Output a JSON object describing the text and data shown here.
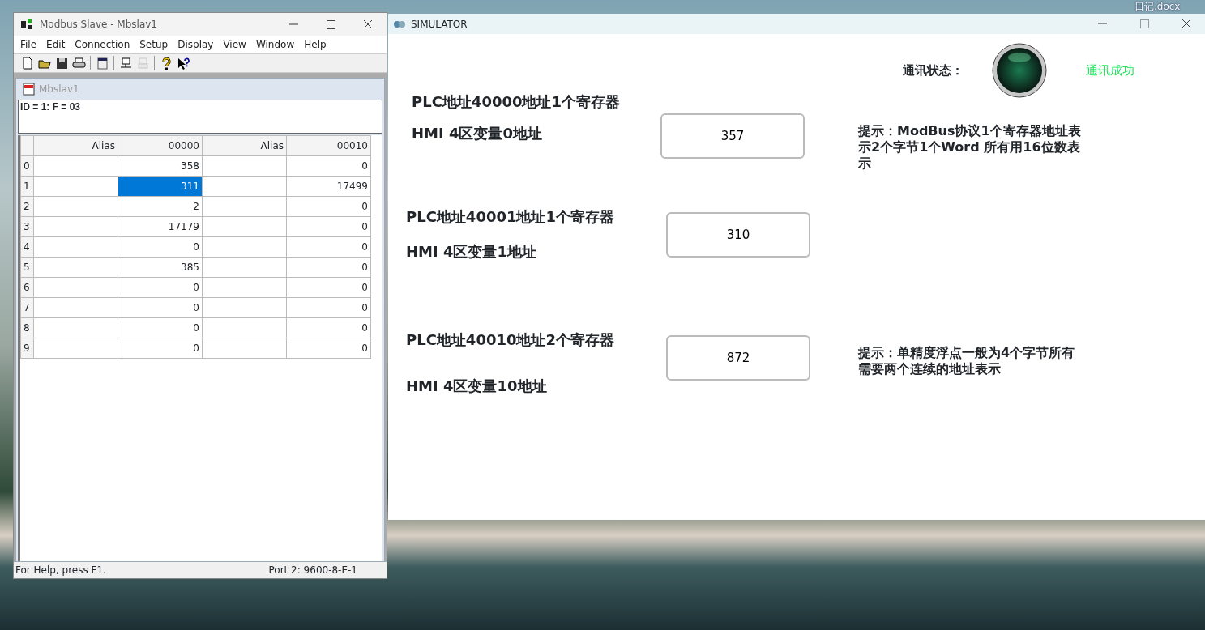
{
  "desktop": {
    "icon_label": "日记.docx"
  },
  "modbus_window": {
    "title": "Modbus Slave - Mbslav1",
    "menu": [
      "File",
      "Edit",
      "Connection",
      "Setup",
      "Display",
      "View",
      "Window",
      "Help"
    ],
    "toolbar": [
      {
        "kind": "new",
        "disabled": false
      },
      {
        "kind": "open",
        "disabled": false
      },
      {
        "kind": "save",
        "disabled": false
      },
      {
        "kind": "print",
        "disabled": false
      },
      {
        "kind": "sep"
      },
      {
        "kind": "window",
        "disabled": false
      },
      {
        "kind": "sep"
      },
      {
        "kind": "connect",
        "disabled": false
      },
      {
        "kind": "disconnect",
        "disabled": true
      },
      {
        "kind": "sep"
      },
      {
        "kind": "help",
        "disabled": false
      },
      {
        "kind": "context-help",
        "disabled": false
      }
    ],
    "child": {
      "title": "Mbslav1",
      "header": "ID = 1: F = 03",
      "columns": [
        {
          "heading": "Alias",
          "kind": "alias"
        },
        {
          "heading": "00000",
          "kind": "value"
        },
        {
          "heading": "Alias",
          "kind": "alias"
        },
        {
          "heading": "00010",
          "kind": "value"
        }
      ],
      "rows": [
        {
          "header": "0",
          "cells": [
            {
              "text": "",
              "selected": false
            },
            {
              "text": "358",
              "selected": false
            },
            {
              "text": "",
              "selected": false
            },
            {
              "text": "0",
              "selected": false
            }
          ]
        },
        {
          "header": "1",
          "cells": [
            {
              "text": "",
              "selected": false
            },
            {
              "text": "311",
              "selected": true
            },
            {
              "text": "",
              "selected": false
            },
            {
              "text": "17499",
              "selected": false
            }
          ]
        },
        {
          "header": "2",
          "cells": [
            {
              "text": "",
              "selected": false
            },
            {
              "text": "2",
              "selected": false
            },
            {
              "text": "",
              "selected": false
            },
            {
              "text": "0",
              "selected": false
            }
          ]
        },
        {
          "header": "3",
          "cells": [
            {
              "text": "",
              "selected": false
            },
            {
              "text": "17179",
              "selected": false
            },
            {
              "text": "",
              "selected": false
            },
            {
              "text": "0",
              "selected": false
            }
          ]
        },
        {
          "header": "4",
          "cells": [
            {
              "text": "",
              "selected": false
            },
            {
              "text": "0",
              "selected": false
            },
            {
              "text": "",
              "selected": false
            },
            {
              "text": "0",
              "selected": false
            }
          ]
        },
        {
          "header": "5",
          "cells": [
            {
              "text": "",
              "selected": false
            },
            {
              "text": "385",
              "selected": false
            },
            {
              "text": "",
              "selected": false
            },
            {
              "text": "0",
              "selected": false
            }
          ]
        },
        {
          "header": "6",
          "cells": [
            {
              "text": "",
              "selected": false
            },
            {
              "text": "0",
              "selected": false
            },
            {
              "text": "",
              "selected": false
            },
            {
              "text": "0",
              "selected": false
            }
          ]
        },
        {
          "header": "7",
          "cells": [
            {
              "text": "",
              "selected": false
            },
            {
              "text": "0",
              "selected": false
            },
            {
              "text": "",
              "selected": false
            },
            {
              "text": "0",
              "selected": false
            }
          ]
        },
        {
          "header": "8",
          "cells": [
            {
              "text": "",
              "selected": false
            },
            {
              "text": "0",
              "selected": false
            },
            {
              "text": "",
              "selected": false
            },
            {
              "text": "0",
              "selected": false
            }
          ]
        },
        {
          "header": "9",
          "cells": [
            {
              "text": "",
              "selected": false
            },
            {
              "text": "0",
              "selected": false
            },
            {
              "text": "",
              "selected": false
            },
            {
              "text": "0",
              "selected": false
            }
          ]
        }
      ]
    },
    "status_bar": {
      "help": "For Help, press F1.",
      "port": "Port 2: 9600-8-E-1"
    }
  },
  "simulator": {
    "title": "SIMULATOR",
    "status_label": "通讯状态：",
    "status_text": "通讯成功",
    "sections": [
      {
        "plc": "PLC地址40000地址1个寄存器",
        "hmi": "HMI 4区变量0地址",
        "value": "357",
        "hint": "提示：ModBus协议1个寄存器地址表示2个字节1个Word 所有用16位数表示"
      },
      {
        "plc": "PLC地址40001地址1个寄存器",
        "hmi": "HMI 4区变量1地址",
        "value": "310"
      },
      {
        "plc": "PLC地址40010地址2个寄存器",
        "hmi": "HMI 4区变量10地址",
        "value": "872",
        "hint": "提示：单精度浮点一般为4个字节所有需要两个连续的地址表示"
      }
    ]
  }
}
